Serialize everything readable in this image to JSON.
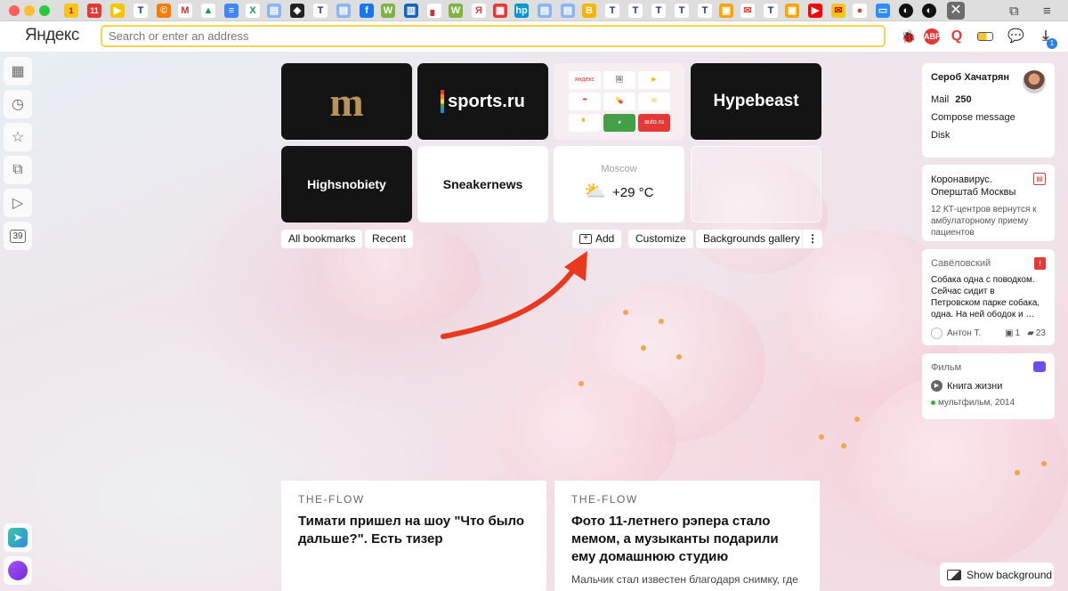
{
  "browser": {
    "logo": "Яндекс",
    "address_placeholder": "Search or enter an address",
    "download_badge": "1",
    "tab_badges": {
      "mail": "1",
      "calendar": "11"
    }
  },
  "sidebar": {
    "tabs_counter": "39"
  },
  "speed_dial": {
    "tiles": [
      {
        "label": "m"
      },
      {
        "label": "sports.ru"
      },
      {
        "label": "Yandex services"
      },
      {
        "label": "Hypebeast"
      },
      {
        "label": "Highsnobiety"
      },
      {
        "label": "Sneakernews"
      },
      {
        "city": "Moscow",
        "temp": "+29 °C"
      }
    ],
    "mini": {
      "mail": "яндекс",
      "auto": "auto.ru"
    }
  },
  "controls": {
    "all_bookmarks": "All bookmarks",
    "recent": "Recent",
    "add": "Add",
    "customize": "Customize",
    "backgrounds_gallery": "Backgrounds gallery"
  },
  "user_card": {
    "name": "Сероб Хачатрян",
    "mail_label": "Mail",
    "mail_count": "250",
    "compose": "Compose message",
    "disk": "Disk"
  },
  "news_card": {
    "title": "Коронавирус. Оперштаб Москвы",
    "text": "12 КТ-центров вернутся к амбулаторному приему пациентов"
  },
  "district_card": {
    "title": "Савёловский",
    "text": "Собака одна с поводком. Сейчас сидит в Петровском парке собака, одна. На ней ободок и …",
    "author": "Антон Т.",
    "images": "1",
    "comments": "23"
  },
  "film_card": {
    "label": "Фильм",
    "title": "Книга жизни",
    "meta": "мультфильм, 2014"
  },
  "zen": [
    {
      "source": "THE-FLOW",
      "title": "Тимати пришел на шоу \"Что было дальше?\". Есть тизер",
      "desc": ""
    },
    {
      "source": "THE-FLOW",
      "title": "Фото 11-летнего рэпера стало мемом, а музыканты подарили ему домашнюю студию",
      "desc": "Мальчик стал известен благодаря снимку, где"
    }
  ],
  "show_background": "Show background",
  "colors": {
    "accent_yellow": "#fcd34d",
    "arrow": "#e8391f",
    "dark_tile": "#141414"
  }
}
